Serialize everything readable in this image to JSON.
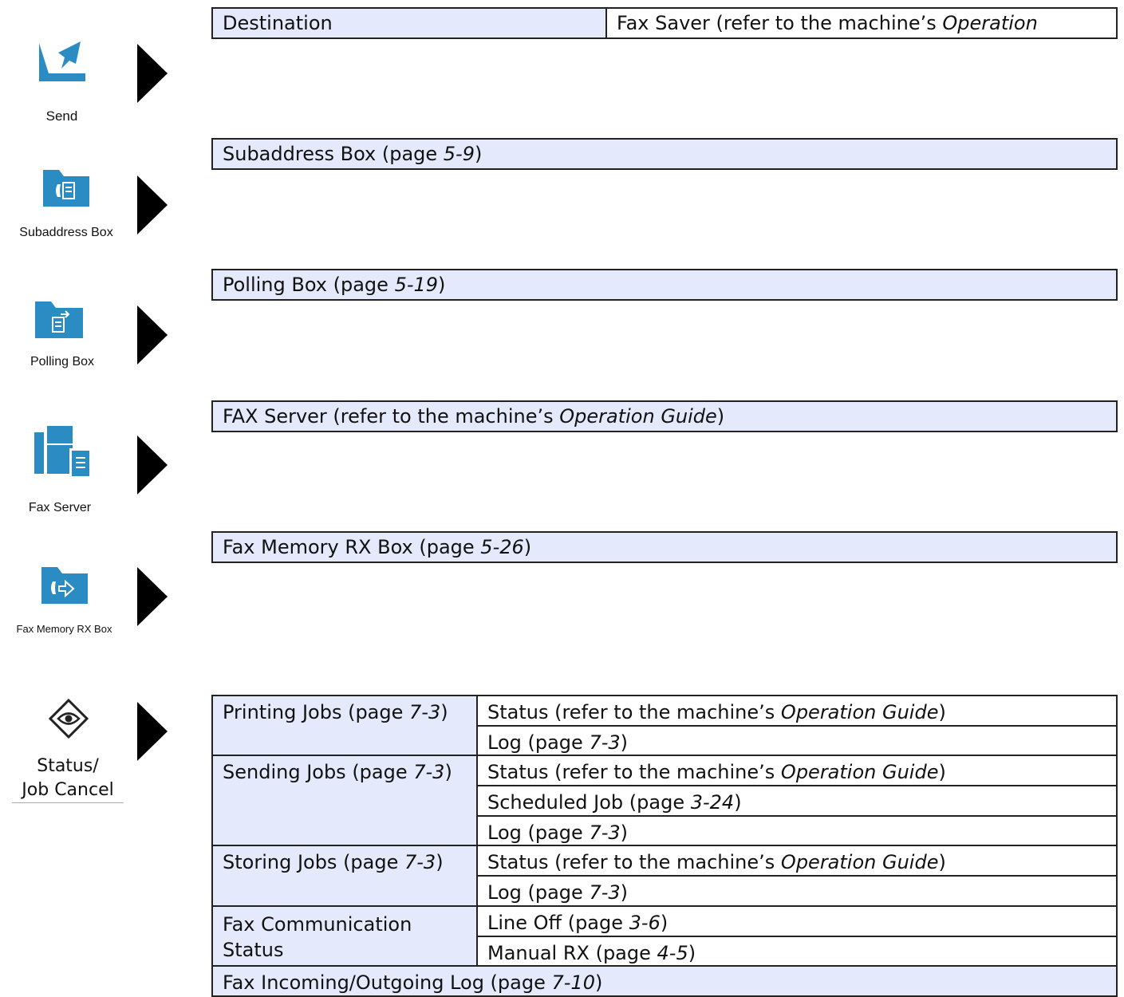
{
  "colors": {
    "accent": "#2b8cc4",
    "box_fill": "#e4eafb",
    "border": "#222222"
  },
  "icons": [
    {
      "name": "send-icon",
      "label": "Send"
    },
    {
      "name": "subaddress-box-icon",
      "label": "Subaddress Box"
    },
    {
      "name": "polling-box-icon",
      "label": "Polling Box"
    },
    {
      "name": "fax-server-icon",
      "label": "Fax Server"
    },
    {
      "name": "fax-memory-rx-box-icon",
      "label": "Fax Memory RX Box"
    },
    {
      "name": "status-job-cancel-icon",
      "label_line1": "Status/",
      "label_line2": "Job Cancel"
    }
  ],
  "destination": {
    "left": "Destination",
    "right_prefix": "Fax Saver (refer to the machine’s ",
    "right_italic": "Operation"
  },
  "subaddress": {
    "prefix": "Subaddress Box (page ",
    "page": "5-9",
    "suffix": ")"
  },
  "polling": {
    "prefix": "Polling Box (page ",
    "page": "5-19",
    "suffix": ")"
  },
  "fax_server": {
    "prefix": "FAX Server (refer to the machine’s ",
    "italic": "Operation Guide",
    "suffix": ")"
  },
  "fax_memory": {
    "prefix": "Fax Memory RX Box (page ",
    "page": "5-26",
    "suffix": ")"
  },
  "jobs": {
    "printing": {
      "prefix": "Printing Jobs (page ",
      "page": "7-3",
      "suffix": ")"
    },
    "sending": {
      "prefix": "Sending Jobs (page ",
      "page": "7-3",
      "suffix": ")"
    },
    "storing": {
      "prefix": "Storing Jobs (page ",
      "page": "7-3",
      "suffix": ")"
    },
    "fax_comm": {
      "line1": "Fax Communication",
      "line2": "Status"
    },
    "status_prefix": "Status (refer to the machine’s ",
    "status_italic": "Operation Guide",
    "status_suffix": ")",
    "log": {
      "prefix": "Log (page ",
      "page": "7-3",
      "suffix": ")"
    },
    "scheduled": {
      "prefix": "Scheduled Job (page ",
      "page": "3-24",
      "suffix": ")"
    },
    "line_off": {
      "prefix": "Line Off (page ",
      "page": "3-6",
      "suffix": ")"
    },
    "manual_rx": {
      "prefix": "Manual RX (page ",
      "page": "4-5",
      "suffix": ")"
    },
    "fax_log": {
      "prefix": "Fax Incoming/Outgoing Log (page ",
      "page": "7-10",
      "suffix": ")"
    }
  }
}
